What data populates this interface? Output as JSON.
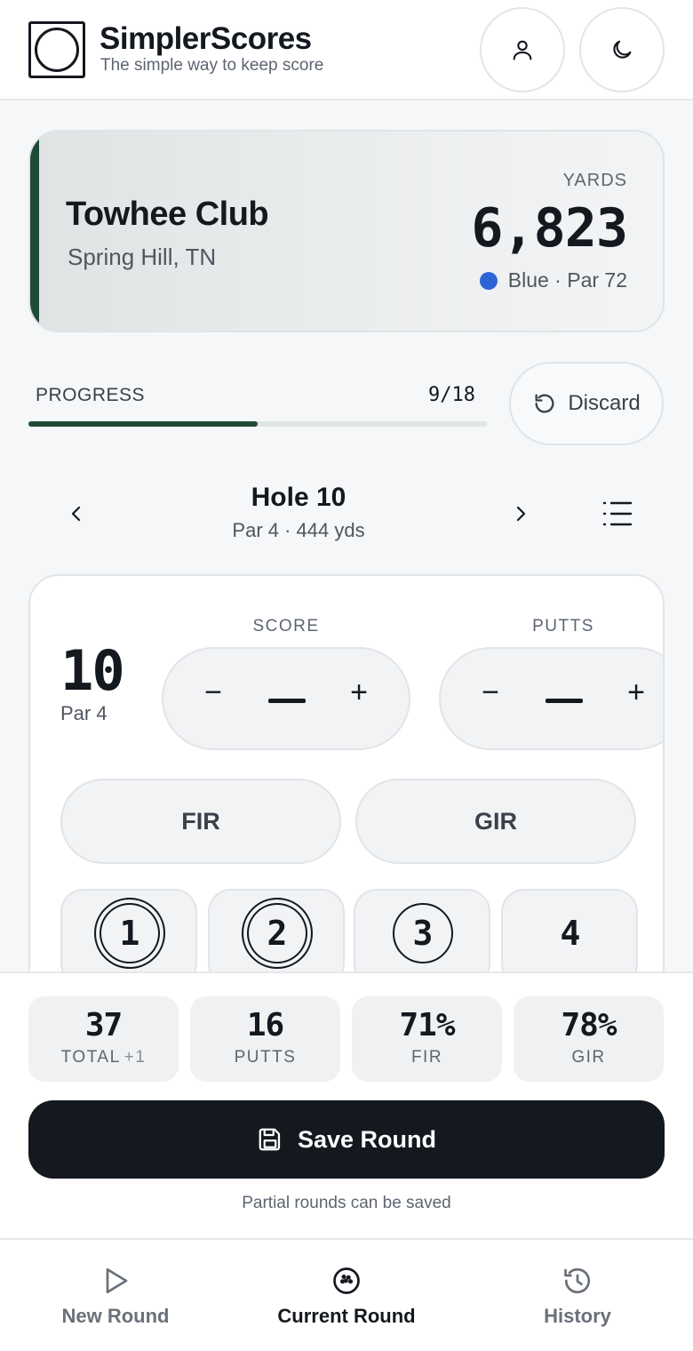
{
  "app": {
    "name": "SimplerScores",
    "tagline": "The simple way to keep score"
  },
  "header": {
    "icons": [
      "user-icon",
      "moon-icon"
    ]
  },
  "course": {
    "name": "Towhee Club",
    "location": "Spring Hill, TN",
    "yards_label": "YARDS",
    "yards": "6,823",
    "tee": "Blue · Par 72",
    "tee_color": "#2e63d8",
    "accent_color": "#1f4a37"
  },
  "progress": {
    "label": "PROGRESS",
    "count": "9/18",
    "fraction": 0.5,
    "discard_label": "Discard"
  },
  "hole": {
    "title": "Hole 10",
    "subtitle": "Par 4 · 444 yds",
    "number": "10",
    "par": "Par 4"
  },
  "entry": {
    "score_label": "SCORE",
    "putts_label": "PUTTS",
    "minus": "−",
    "plus": "+",
    "fir_label": "FIR",
    "gir_label": "GIR",
    "putt_options": [
      "1",
      "2",
      "3",
      "4"
    ]
  },
  "summary": {
    "total_value": "37",
    "total_label": "TOTAL",
    "total_diff": "+1",
    "putts_value": "16",
    "putts_label": "PUTTS",
    "fir_value": "71%",
    "fir_label": "FIR",
    "gir_value": "78%",
    "gir_label": "GIR"
  },
  "save": {
    "label": "Save Round",
    "note": "Partial rounds can be saved"
  },
  "tabs": [
    {
      "label": "New Round",
      "icon": "play-icon"
    },
    {
      "label": "Current Round",
      "icon": "golf-ball-icon",
      "active": true
    },
    {
      "label": "History",
      "icon": "history-icon"
    }
  ]
}
